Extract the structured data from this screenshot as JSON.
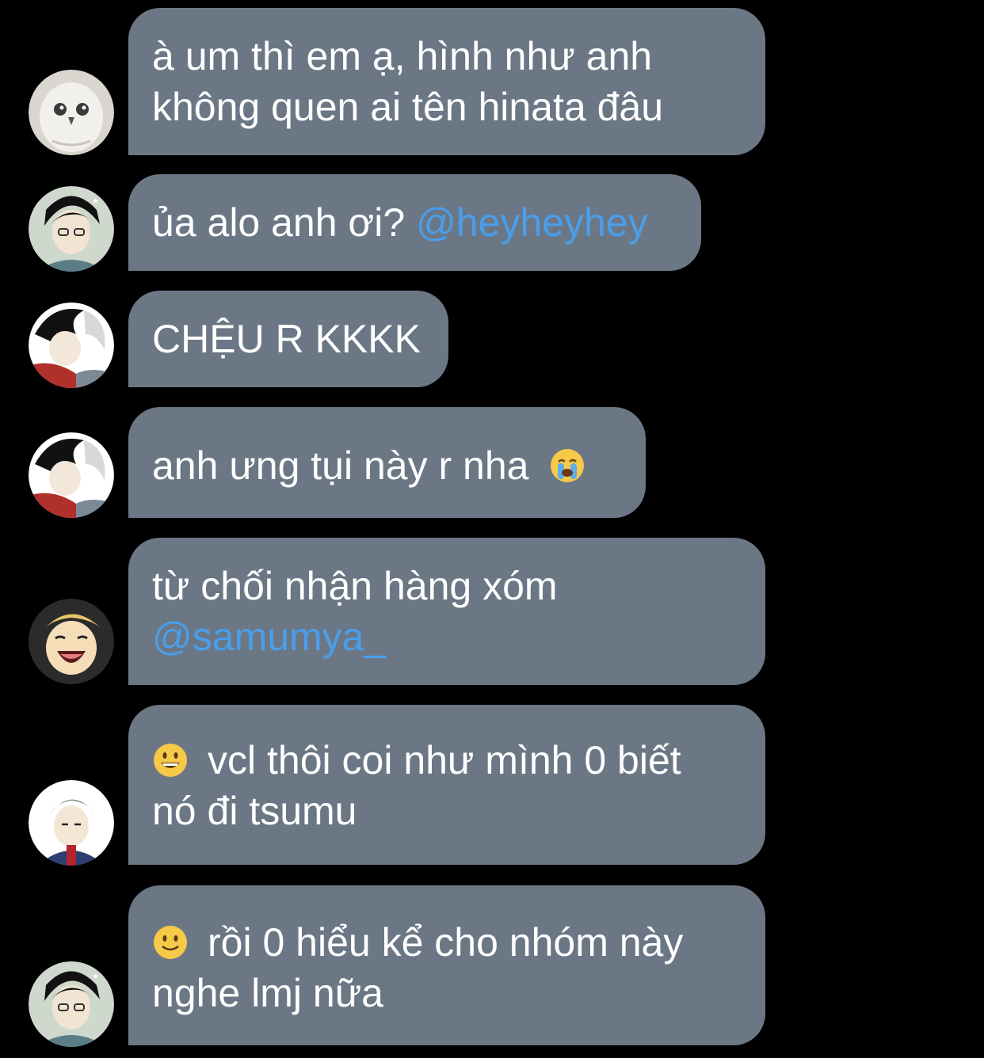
{
  "messages": [
    {
      "avatar": "owl-avatar",
      "lines": [
        "à um thì em ạ, hình như anh",
        "không quen ai tên hinata đâu"
      ]
    },
    {
      "avatar": "akaashi-avatar",
      "text": "ủa alo anh ơi?",
      "mention": "@heyheyhey"
    },
    {
      "avatar": "kuroo-avatar",
      "text": "CHỆU R KKKK"
    },
    {
      "avatar": "kuroo-avatar",
      "text": "anh ưng tụi này r nha",
      "trailing_emoji": "loudly-crying-face"
    },
    {
      "avatar": "laughing-avatar",
      "line1": "từ chối nhận hàng xóm",
      "mention": "@samumya_"
    },
    {
      "avatar": "grey-hair-avatar",
      "leading_emoji": "grinning-face",
      "line1": "vcl thôi coi như mình 0 biết",
      "line2": "nó đi tsumu"
    },
    {
      "avatar": "akaashi-avatar",
      "leading_emoji": "slightly-smiling-face",
      "line1": "rồi 0 hiểu kể cho nhóm này",
      "line2": "nghe lmj nữa"
    }
  ],
  "colors": {
    "background": "#000000",
    "bubble": "#6b7785",
    "text": "#ffffff",
    "mention": "#4a9eea"
  }
}
